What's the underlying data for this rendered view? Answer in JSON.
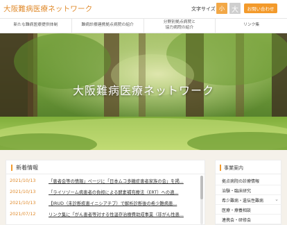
{
  "header": {
    "logo_text": "大阪難病医療ネットワーク",
    "font_size_label": "文字サイズ",
    "font_small": "小",
    "font_large": "大",
    "contact_label": "お問い合わせ"
  },
  "nav": {
    "items": [
      {
        "label": "新たな難病医療提供体制"
      },
      {
        "label": "難病診療連携拠点病院の紹介"
      },
      {
        "label": "分野別拠点病院と\n協力病院の紹介"
      },
      {
        "label": "リンク集"
      }
    ]
  },
  "hero": {
    "title": "大阪難病医療ネットワーク"
  },
  "news": {
    "title": "新着情報",
    "items": [
      {
        "date": "2021/10/13",
        "text": "「患者会等の情報」ページに「日本ムコ多糖症患者家族の会」を掲..."
      },
      {
        "date": "2021/10/13",
        "text": "「ライソゾーム病患者の負担による酵素補充療法（ERT）への適..."
      },
      {
        "date": "2021/10/13",
        "text": "【IRUD（未診断疾患イニシアチブ）で解析診断後の希少難病患..."
      },
      {
        "date": "2021/07/12",
        "text": "リンク集に「がん患者等対する性温存治療費助成事業（非がん性患..."
      }
    ]
  },
  "sidebar": {
    "title": "事業案内",
    "items": [
      {
        "label": "拠点病院の診療情報",
        "has_children": false
      },
      {
        "label": "治験・臨床研究",
        "has_children": false
      },
      {
        "label": "希少難病・遺伝性難病",
        "has_children": true
      },
      {
        "label": "医療・療養相談",
        "has_children": false
      },
      {
        "label": "連携会・研修会",
        "has_children": false
      }
    ]
  },
  "colors": {
    "accent": "#f39a2b",
    "logo": "#e08a2b",
    "date": "#e08a2b",
    "lower_bg": "#f5f1ea"
  }
}
